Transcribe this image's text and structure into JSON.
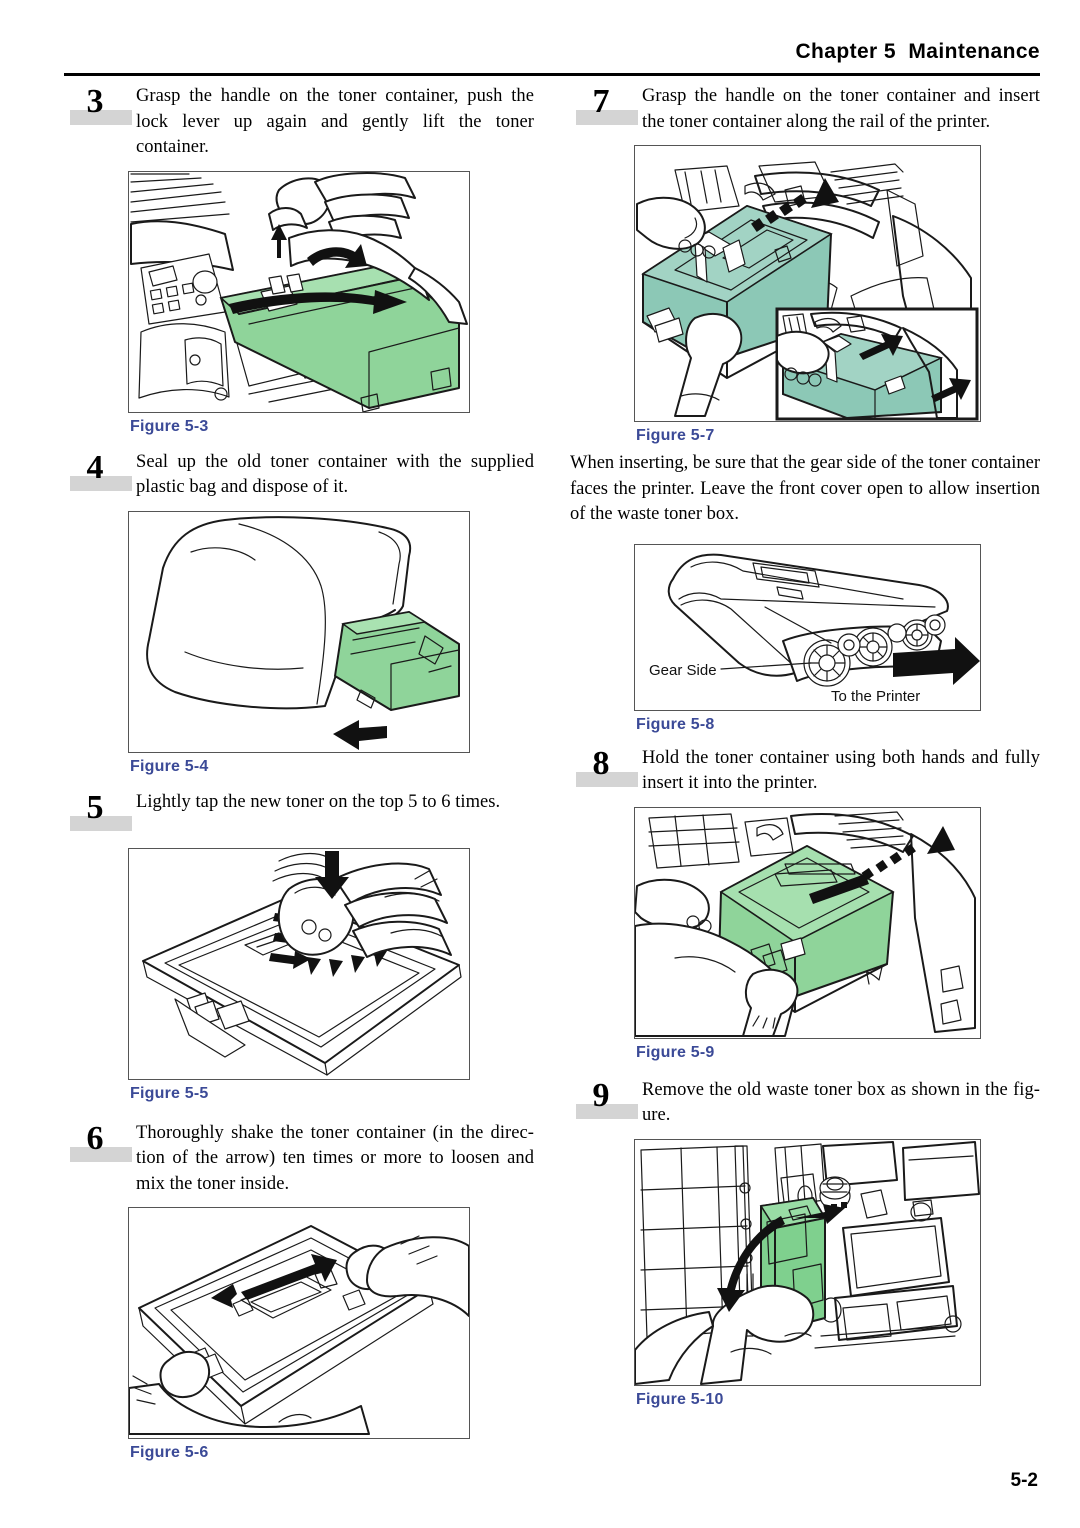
{
  "header": {
    "chapter_label": "Chapter 5",
    "title": "Maintenance",
    "full": "Chapter 5  Maintenance"
  },
  "page_number": "5-2",
  "colors": {
    "figure_caption": "#3b4a97",
    "toner_green": "#8fd49a",
    "toner_green_teal": "#8cc8b6",
    "step_bar_gray": "#d4d4d4",
    "rule_black": "#000000"
  },
  "left_column": {
    "steps": [
      {
        "number": "3",
        "text": "Grasp the handle on the toner container, push the lock lever up again and gently lift the toner container.",
        "figure": {
          "caption": "Figure 5-3",
          "illustration": "printer-top-with-hands-lifting-green-toner-container"
        }
      },
      {
        "number": "4",
        "text": "Seal up the old toner container with the supplied plastic bag and dispose of it.",
        "figure": {
          "caption": "Figure 5-4",
          "illustration": "plastic-bag-with-green-toner-container-and-arrow"
        }
      },
      {
        "number": "5",
        "text": "Lightly tap the new toner on the top 5 to 6 times.",
        "figure": {
          "caption": "Figure 5-5",
          "illustration": "hand-tapping-toner-container-top-with-down-arrow"
        }
      },
      {
        "number": "6",
        "text": "Thoroughly shake the toner container (in the direc-tion of the arrow) ten times or more to loosen and mix the toner inside.",
        "figure": {
          "caption": "Figure 5-6",
          "illustration": "two-hands-shaking-toner-container-double-arrow"
        }
      }
    ]
  },
  "right_column": {
    "steps": [
      {
        "number": "7",
        "text": "Grasp the handle on the toner container and insert the toner container along the rail of the printer.",
        "figure": {
          "caption": "Figure 5-7",
          "illustration": "inserting-green-toner-container-along-rail-with-inset-detail"
        }
      }
    ],
    "note_paragraph": "When inserting, be sure that the gear side of the toner container faces the printer. Leave the front cover open to allow insertion of the waste toner box.",
    "note_figure": {
      "caption": "Figure 5-8",
      "illustration": "toner-container-underside-showing-gears",
      "labels": {
        "gear_side": "Gear Side",
        "to_the_printer": "To the Printer"
      }
    },
    "steps_after": [
      {
        "number": "8",
        "text": "Hold the toner container using both hands and fully insert it into the printer.",
        "figure": {
          "caption": "Figure 5-9",
          "illustration": "both-hands-inserting-green-toner-container-into-printer"
        }
      },
      {
        "number": "9",
        "text": "Remove the old waste toner box as shown in the fig-ure.",
        "figure": {
          "caption": "Figure 5-10",
          "illustration": "hand-removing-green-waste-toner-box-with-rotation-arrow"
        }
      }
    ]
  }
}
